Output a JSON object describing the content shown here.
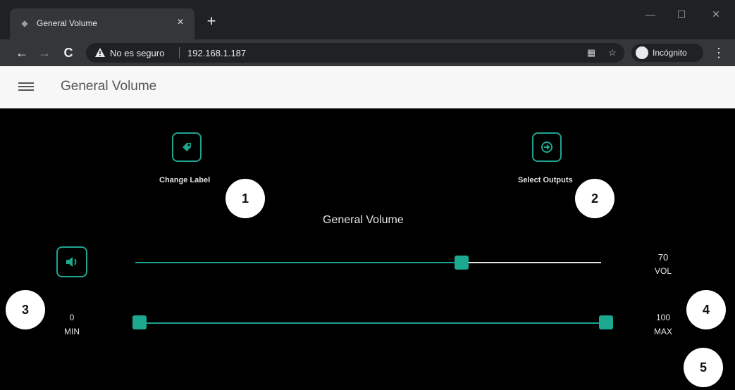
{
  "browser": {
    "tab_title": "General Volume",
    "tab_close": "×",
    "new_tab": "+",
    "window_controls": [
      "—",
      "☐",
      "✕"
    ],
    "nav_back": "←",
    "nav_forward": "→",
    "reload": "C",
    "security_text": "No es seguro",
    "url": "192.168.1.187",
    "incognito_label": "Incógnito",
    "menu": "⋮",
    "translate_icon": "translate-icon",
    "bookmark_icon": "☆"
  },
  "appbar": {
    "title": "General Volume"
  },
  "main": {
    "change_label_caption": "Change Label",
    "select_outputs_caption": "Select Outputs",
    "section_title": "General Volume",
    "volume": {
      "value": 70,
      "value_text": "70",
      "unit_label": "VOL",
      "max": 100
    },
    "range": {
      "min_value": "0",
      "min_label": "MIN",
      "max_value": "100",
      "max_label": "MAX",
      "low": 0,
      "high": 100
    },
    "accent_color": "#1ba88f"
  },
  "callouts": [
    "1",
    "2",
    "3",
    "4",
    "5"
  ]
}
